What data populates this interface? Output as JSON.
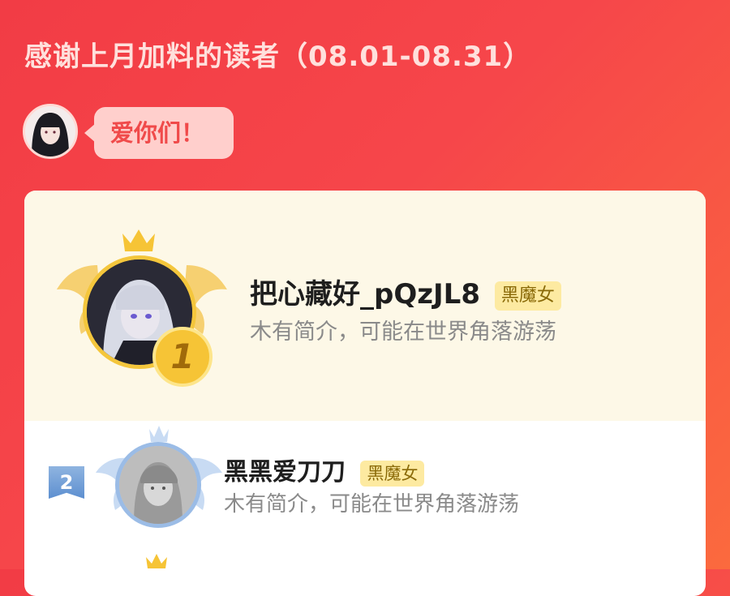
{
  "header": {
    "title": "感谢上月加料的读者（08.01-08.31）",
    "message": "爱你们！"
  },
  "ranking": [
    {
      "rank": "1",
      "name": "把心藏好_pQzJL8",
      "tag": "黑魔女",
      "bio": "木有简介，可能在世界角落游荡"
    },
    {
      "rank": "2",
      "name": "黑黑爱刀刀",
      "tag": "黑魔女",
      "bio": "木有简介，可能在世界角落游荡"
    }
  ],
  "colors": {
    "background": "#f23c45",
    "gold": "#f4c63c",
    "silver_blue": "#9bbce6",
    "tag_bg": "#fdeaa1"
  }
}
